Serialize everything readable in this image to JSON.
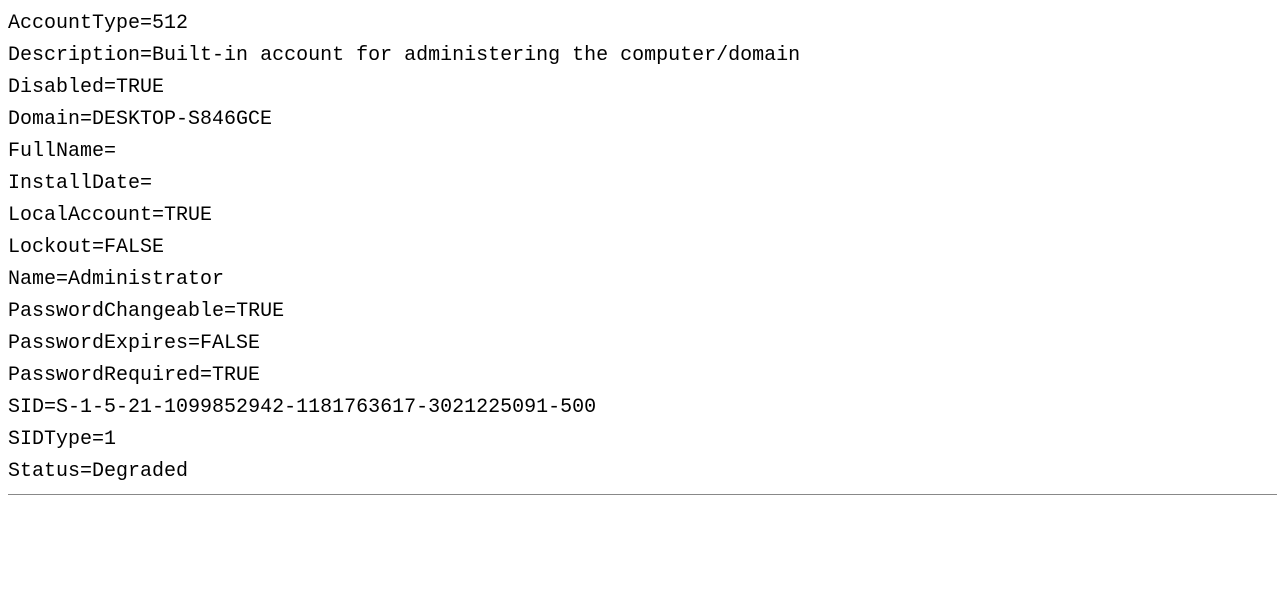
{
  "account": {
    "lines": [
      {
        "key": "AccountType",
        "value": "512"
      },
      {
        "key": "Description",
        "value": "Built-in account for administering the computer/domain"
      },
      {
        "key": "Disabled",
        "value": "TRUE"
      },
      {
        "key": "Domain",
        "value": "DESKTOP-S846GCE"
      },
      {
        "key": "FullName",
        "value": ""
      },
      {
        "key": "InstallDate",
        "value": ""
      },
      {
        "key": "LocalAccount",
        "value": "TRUE"
      },
      {
        "key": "Lockout",
        "value": "FALSE"
      },
      {
        "key": "Name",
        "value": "Administrator"
      },
      {
        "key": "PasswordChangeable",
        "value": "TRUE"
      },
      {
        "key": "PasswordExpires",
        "value": "FALSE"
      },
      {
        "key": "PasswordRequired",
        "value": "TRUE"
      },
      {
        "key": "SID",
        "value": "S-1-5-21-1099852942-1181763617-3021225091-500"
      },
      {
        "key": "SIDType",
        "value": "1"
      },
      {
        "key": "Status",
        "value": "Degraded"
      }
    ]
  }
}
